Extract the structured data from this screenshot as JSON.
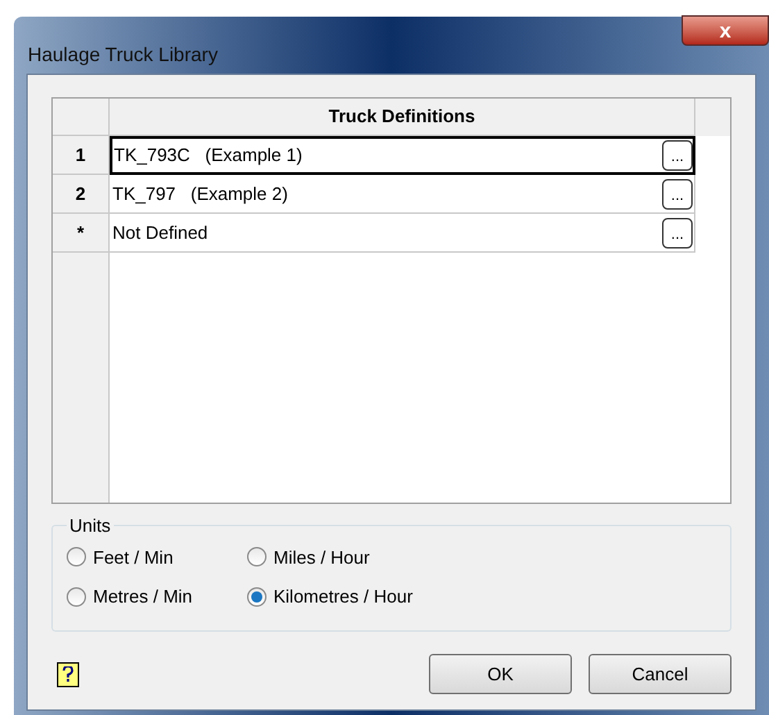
{
  "window": {
    "title": "Haulage Truck Library",
    "close": "x"
  },
  "table": {
    "column": "Truck Definitions",
    "rows": [
      {
        "header": "1",
        "value": "TK_793C   (Example 1)",
        "button": "...",
        "selected": true
      },
      {
        "header": "2",
        "value": "TK_797   (Example 2)",
        "button": "...",
        "selected": false
      },
      {
        "header": "*",
        "value": "Not Defined",
        "button": "...",
        "selected": false
      }
    ]
  },
  "units": {
    "title": "Units",
    "options": [
      {
        "label": "Feet / Min",
        "selected": false
      },
      {
        "label": "Miles / Hour",
        "selected": false
      },
      {
        "label": "Metres / Min",
        "selected": false
      },
      {
        "label": "Kilometres / Hour",
        "selected": true
      }
    ]
  },
  "buttons": [
    "OK",
    "Cancel"
  ]
}
